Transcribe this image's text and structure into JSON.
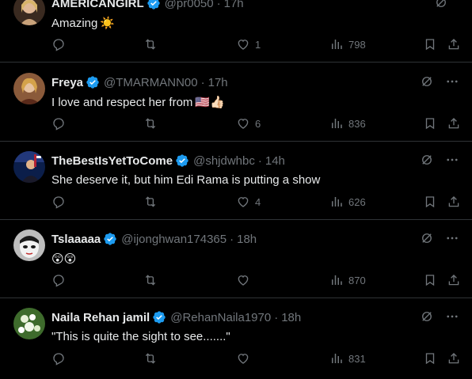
{
  "tweets": [
    {
      "name": "AMERICANGIRL",
      "handle": "@pr0050",
      "time": "17h",
      "text": "Amazing",
      "emoji": "☀️",
      "stats": {
        "replies": "",
        "reposts": "",
        "likes": "1",
        "views": "798"
      },
      "avatar_color": "#c9a27a"
    },
    {
      "name": "Freya",
      "handle": "@TMARMANN00",
      "time": "17h",
      "text": "I love and respect her from",
      "emoji": "🇺🇸👍🏻",
      "stats": {
        "replies": "",
        "reposts": "",
        "likes": "6",
        "views": "836"
      },
      "avatar_color": "#6b3a2a"
    },
    {
      "name": "TheBestIsYetToCome",
      "handle": "@shjdwhbc",
      "time": "14h",
      "text": "She deserve it, but him Edi Rama is putting a show",
      "emoji": "",
      "stats": {
        "replies": "",
        "reposts": "",
        "likes": "4",
        "views": "626"
      },
      "avatar_color": "#1f3a8a"
    },
    {
      "name": "Tslaaaaa",
      "handle": "@ijonghwan174365",
      "time": "18h",
      "text": "",
      "emoji": "😲😲",
      "stats": {
        "replies": "",
        "reposts": "",
        "likes": "",
        "views": "870"
      },
      "avatar_color": "#d9d9d9"
    },
    {
      "name": "Naila Rehan jamil",
      "handle": "@RehanNaila1970",
      "time": "18h",
      "text": "\"This is quite the sight to see.......\"",
      "emoji": "",
      "stats": {
        "replies": "",
        "reposts": "",
        "likes": "",
        "views": "831"
      },
      "avatar_color": "#4a7a3a"
    }
  ],
  "colors": {
    "background": "#000000",
    "text": "#e7e9ea",
    "muted": "#71767b",
    "verified": "#1d9bf0",
    "divider": "#2f3336"
  },
  "icons": {
    "verified": "verified-badge-icon",
    "grok": "grok-icon",
    "more": "more-icon",
    "reply": "reply-icon",
    "repost": "repost-icon",
    "like": "like-icon",
    "views": "views-icon",
    "bookmark": "bookmark-icon",
    "share": "share-icon"
  }
}
